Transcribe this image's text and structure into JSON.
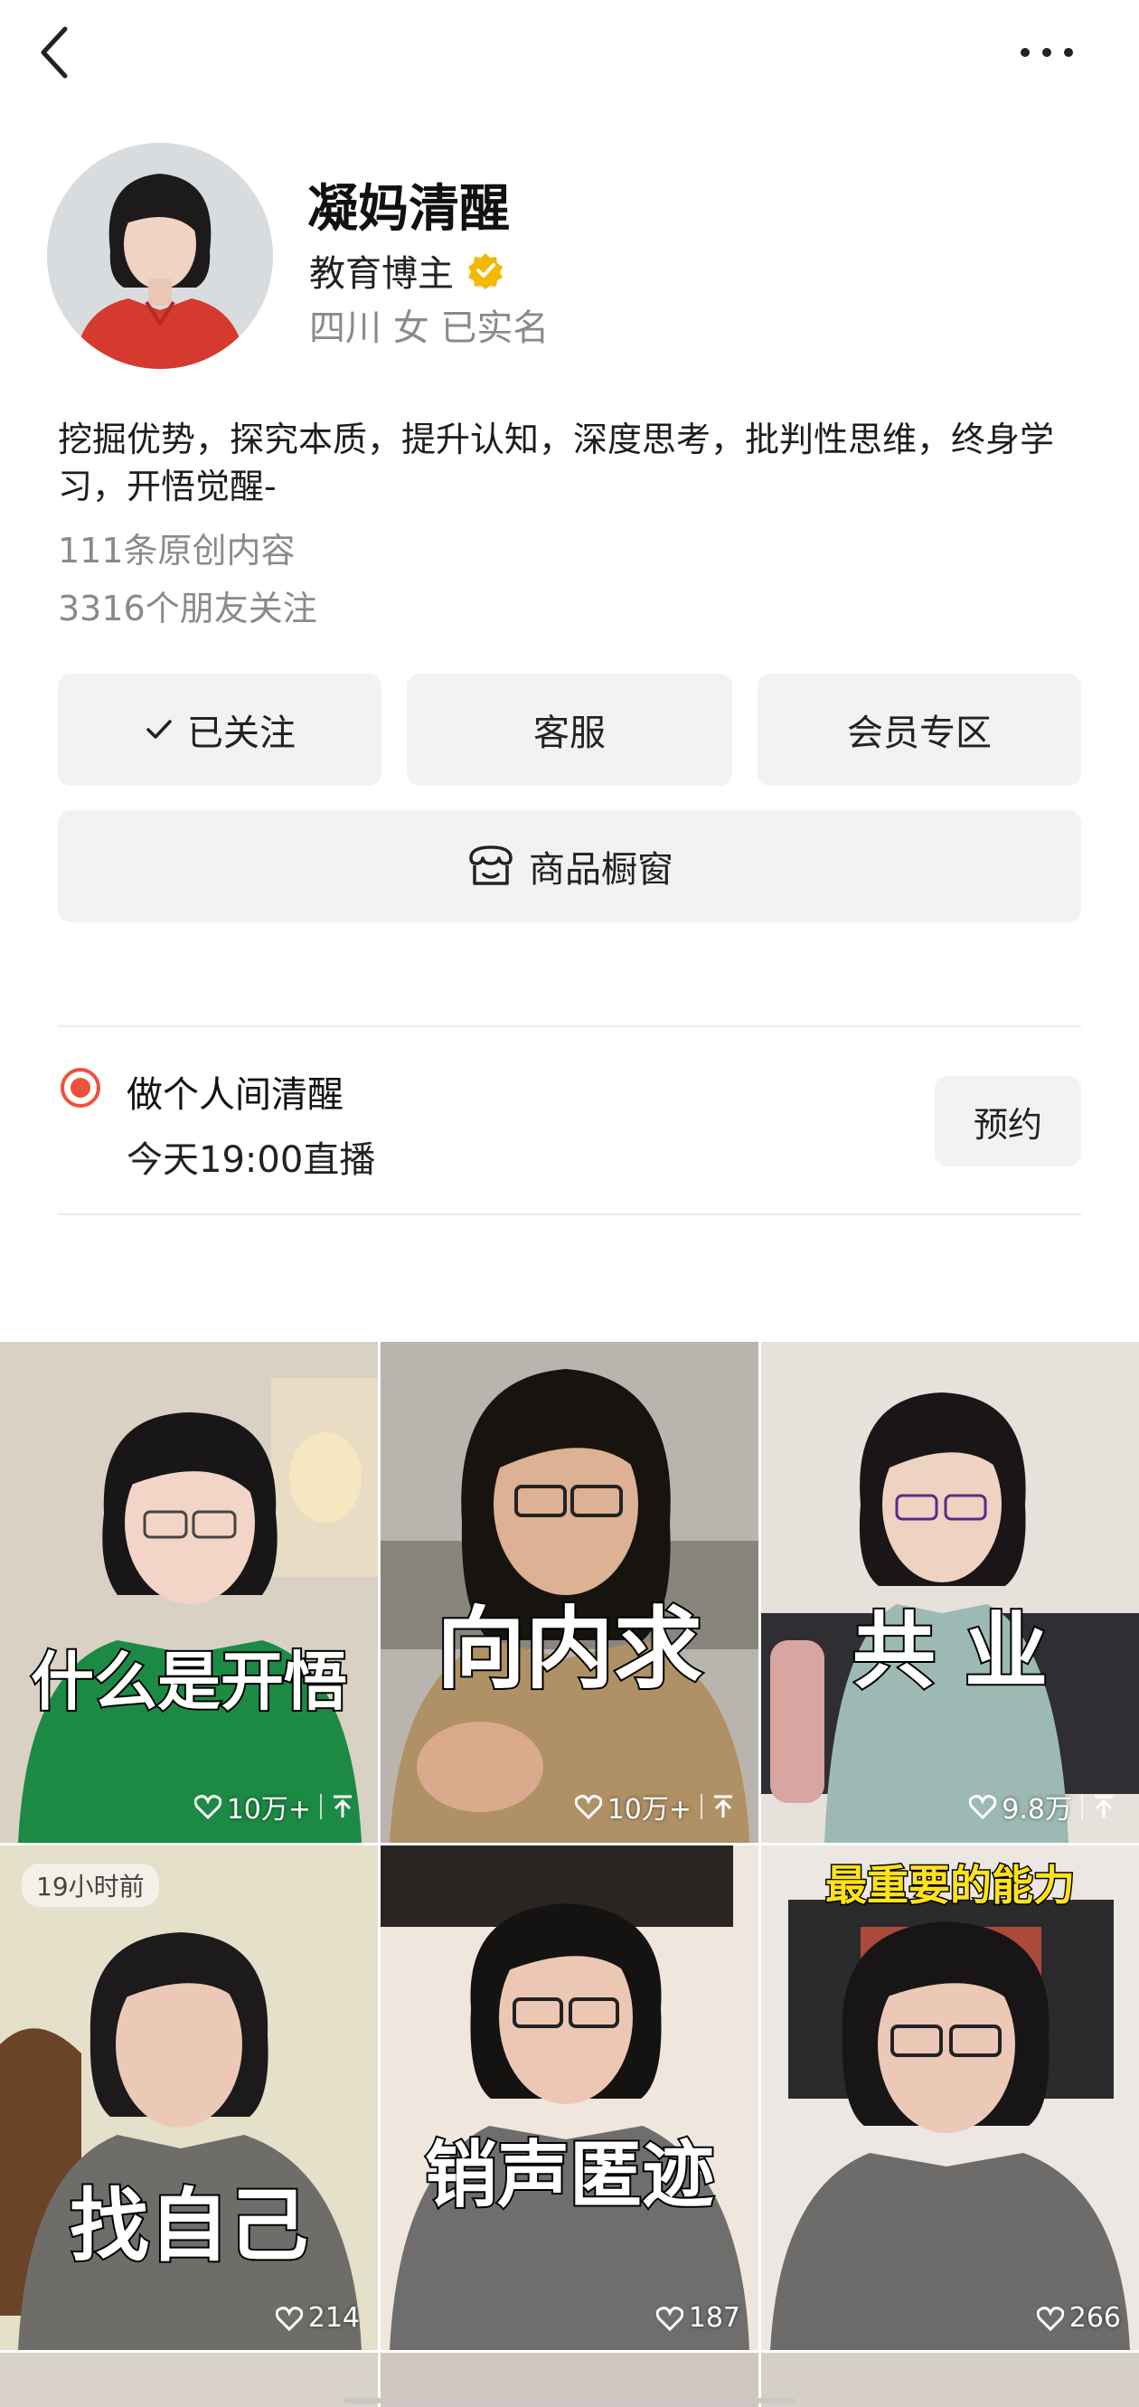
{
  "profile": {
    "name": "凝妈清醒",
    "role": "教育博主",
    "meta": "四川 女 已实名",
    "bio": "挖掘优势，探究本质，提升认知，深度思考，批判性思维，终身学习，开悟觉醒-",
    "original_count": "111条原创内容",
    "friends_following": "3316个朋友关注"
  },
  "buttons": {
    "follow": "已关注",
    "service": "客服",
    "member": "会员专区",
    "shop": "商品橱窗"
  },
  "live": {
    "title": "做个人间清醒",
    "time": "今天19:00直播",
    "reserve": "预约"
  },
  "videos": [
    {
      "caption": "什么是开悟",
      "likes": "10万+",
      "pinned": true
    },
    {
      "caption": "向内求",
      "likes": "10万+",
      "pinned": true
    },
    {
      "caption": "共 业",
      "likes": "9.8万",
      "pinned": true
    },
    {
      "caption": "找自己",
      "likes": "214",
      "badge": "19小时前"
    },
    {
      "caption": "销声匿迹",
      "likes": "187"
    },
    {
      "caption": "",
      "banner": "最重要的能力",
      "likes": "266"
    }
  ],
  "colors": {
    "accent_live": "#f0513a",
    "verified": "#f5b800"
  }
}
